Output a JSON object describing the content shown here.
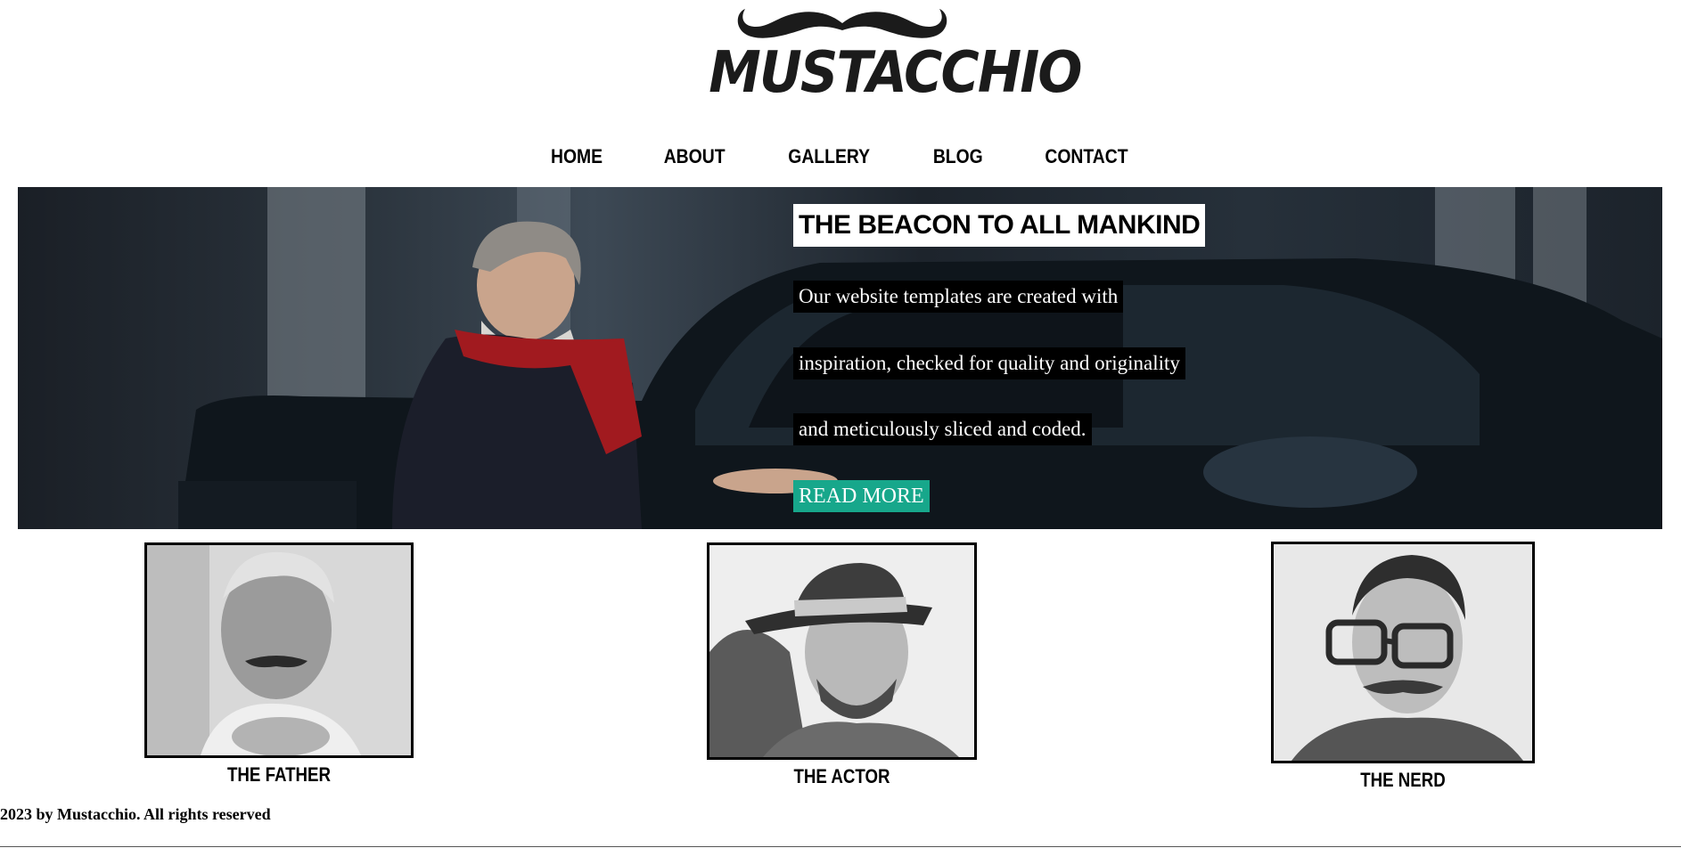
{
  "brand": {
    "name": "MUSTACCHIO",
    "logo_icon": "mustache-icon"
  },
  "nav": {
    "items": [
      {
        "label": "HOME"
      },
      {
        "label": "ABOUT"
      },
      {
        "label": "GALLERY"
      },
      {
        "label": "BLOG"
      },
      {
        "label": "CONTACT"
      }
    ]
  },
  "hero": {
    "title": "THE BEACON TO ALL MANKIND",
    "lines": [
      "Our website templates are created with",
      "inspiration, checked for quality and originality",
      "and meticulously sliced and coded."
    ],
    "cta_label": "READ MORE",
    "cta_color": "#17a78b"
  },
  "cards": [
    {
      "caption": "THE FATHER"
    },
    {
      "caption": "THE ACTOR"
    },
    {
      "caption": "THE NERD"
    }
  ],
  "footer": {
    "text": "2023 by Mustacchio. All rights reserved"
  }
}
